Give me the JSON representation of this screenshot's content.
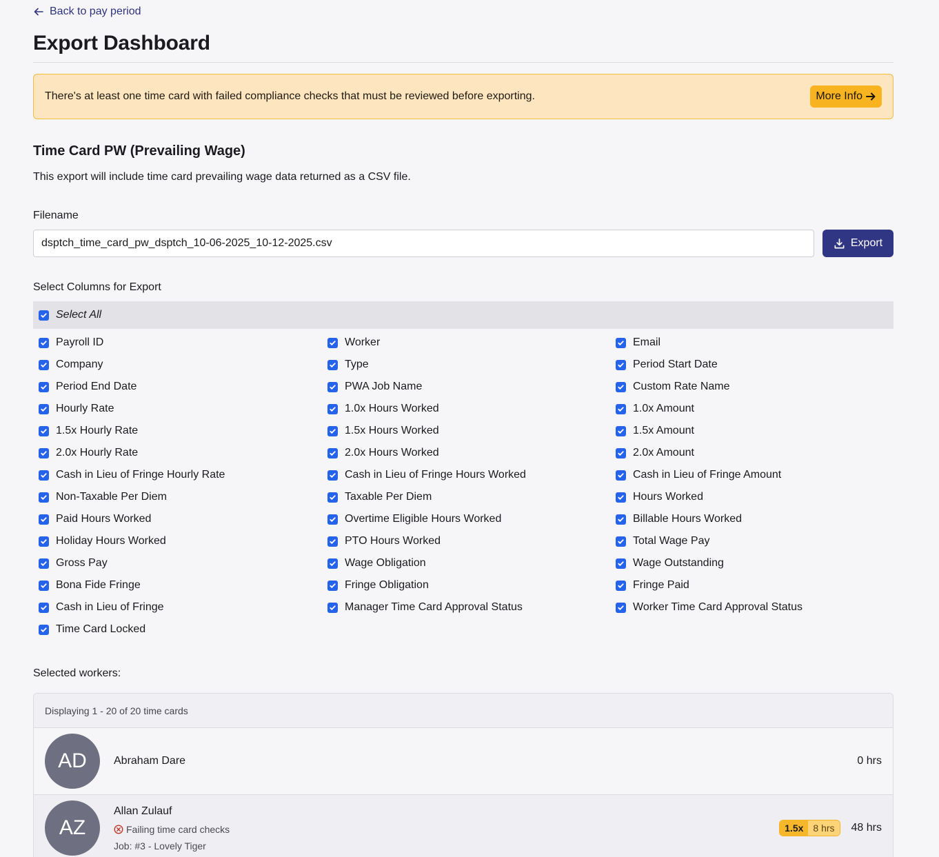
{
  "nav": {
    "back_label": "Back to pay period"
  },
  "page_title": "Export Dashboard",
  "alert": {
    "message": "There's at least one time card with failed compliance checks that must be reviewed before exporting.",
    "button_label": "More Info"
  },
  "export_section": {
    "title": "Time Card PW (Prevailing Wage)",
    "description": "This export will include time card prevailing wage data returned as a CSV file.",
    "filename_label": "Filename",
    "filename_value": "dsptch_time_card_pw_dsptch_10-06-2025_10-12-2025.csv",
    "export_label": "Export"
  },
  "columns": {
    "label": "Select Columns for Export",
    "select_all_label": "Select All",
    "items": [
      "Payroll ID",
      "Worker",
      "Email",
      "Company",
      "Type",
      "Period Start Date",
      "Period End Date",
      "PWA Job Name",
      "Custom Rate Name",
      "Hourly Rate",
      "1.0x Hours Worked",
      "1.0x Amount",
      "1.5x Hourly Rate",
      "1.5x Hours Worked",
      "1.5x Amount",
      "2.0x Hourly Rate",
      "2.0x Hours Worked",
      "2.0x Amount",
      "Cash in Lieu of Fringe Hourly Rate",
      "Cash in Lieu of Fringe Hours Worked",
      "Cash in Lieu of Fringe Amount",
      "Non-Taxable Per Diem",
      "Taxable Per Diem",
      "Hours Worked",
      "Paid Hours Worked",
      "Overtime Eligible Hours Worked",
      "Billable Hours Worked",
      "Holiday Hours Worked",
      "PTO Hours Worked",
      "Total Wage Pay",
      "Gross Pay",
      "Wage Obligation",
      "Wage Outstanding",
      "Bona Fide Fringe",
      "Fringe Obligation",
      "Fringe Paid",
      "Cash in Lieu of Fringe",
      "Manager Time Card Approval Status",
      "Worker Time Card Approval Status",
      "Time Card Locked"
    ]
  },
  "workers": {
    "label": "Selected workers:",
    "displaying": "Displaying 1 - 20 of 20 time cards",
    "rows": [
      {
        "initials": "AD",
        "name": "Abraham Dare",
        "hours": "0 hrs"
      },
      {
        "initials": "AZ",
        "name": "Allan Zulauf",
        "status": "Failing time card checks",
        "job": "Job: #3 - Lovely Tiger",
        "ot_multiplier": "1.5x",
        "ot_hours": "8 hrs",
        "hours": "48 hrs"
      }
    ]
  },
  "colors": {
    "accent": "#303683",
    "checkbox": "#2563eb",
    "alert_bg": "#fde5bf",
    "alert_border": "#f3be3f",
    "warning_button": "#f7b320",
    "avatar": "#6e6f80",
    "error": "#c0392b"
  }
}
